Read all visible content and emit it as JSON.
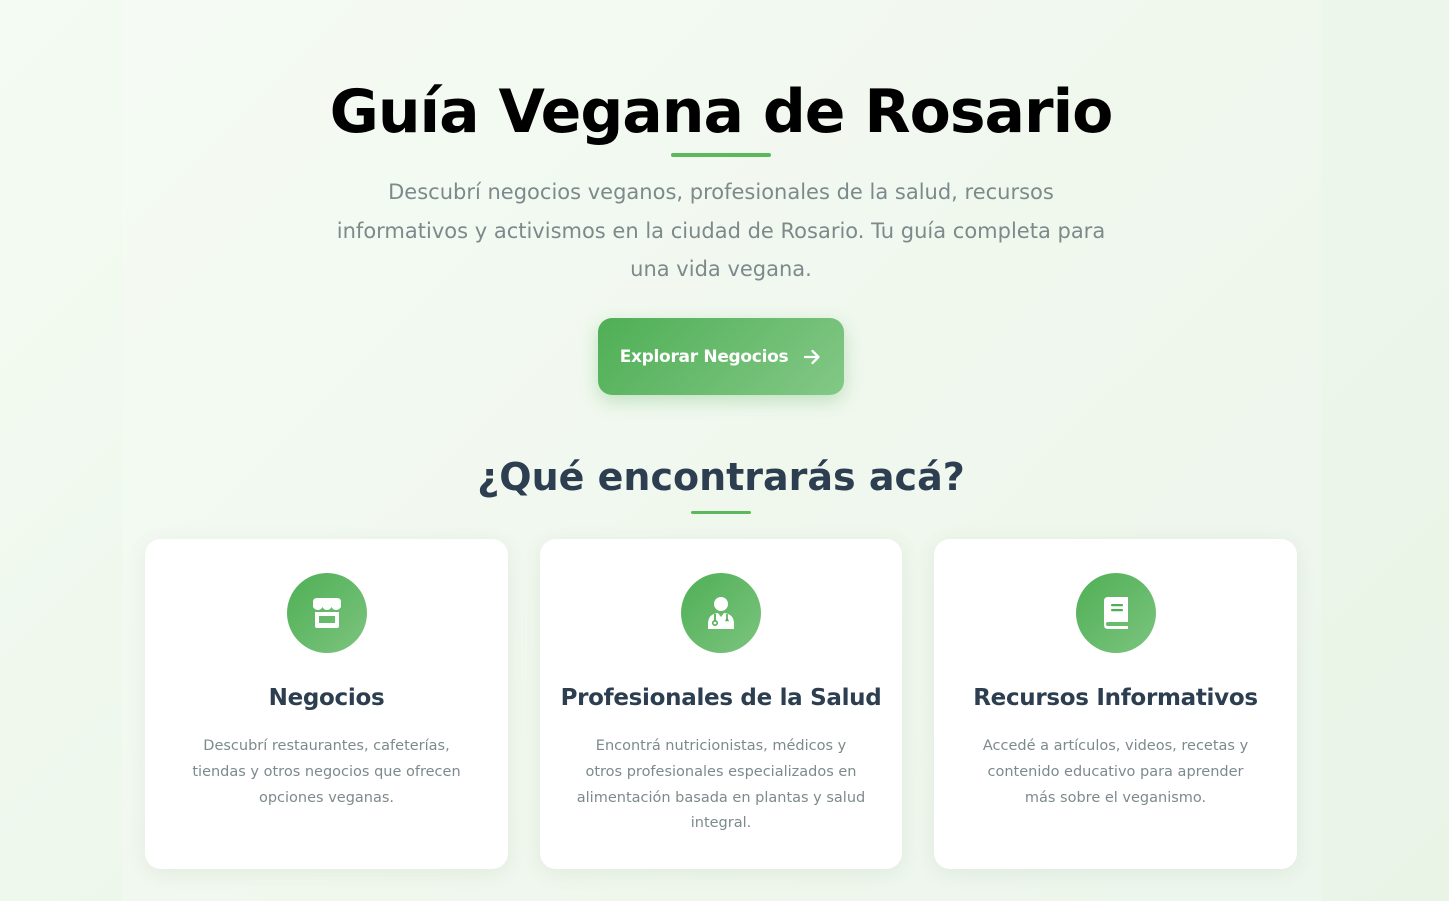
{
  "hero": {
    "title": "Guía Vegana de Rosario",
    "description": "Descubrí negocios veganos, profesionales de la salud, recursos informativos y activismos en la ciudad de Rosario. Tu guía completa para una vida vegana.",
    "cta_label": "Explorar Negocios",
    "cta_icon": "arrow-right-icon"
  },
  "features": {
    "title": "¿Qué encontrarás acá?",
    "cards": [
      {
        "icon": "store-icon",
        "title": "Negocios",
        "description": "Descubrí restaurantes, cafeterías, tiendas y otros negocios que ofrecen opciones veganas."
      },
      {
        "icon": "doctor-icon",
        "title": "Profesionales de la Salud",
        "description": "Encontrá nutricionistas, médicos y otros profesionales especializados en alimentación basada en plantas y salud integral."
      },
      {
        "icon": "book-icon",
        "title": "Recursos Informativos",
        "description": "Accedé a artículos, videos, recetas y contenido educativo para aprender más sobre el veganismo."
      }
    ]
  },
  "colors": {
    "accent": "#4caf50",
    "heading": "#2c3e50",
    "muted_text": "#7d8a8c",
    "background": "#eef7ec"
  }
}
